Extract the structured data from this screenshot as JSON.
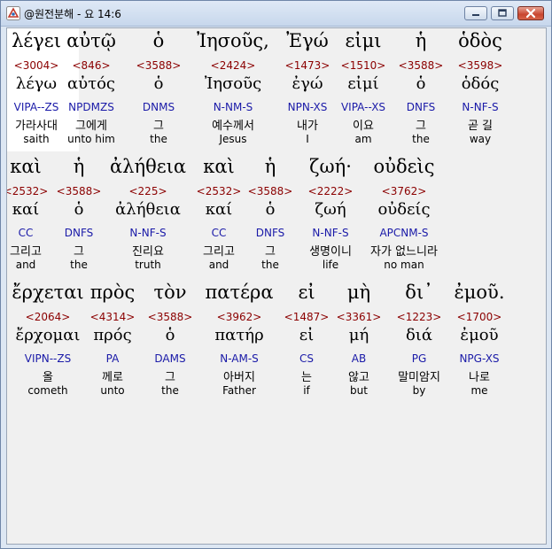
{
  "window": {
    "title": "@원전분해 - 요 14:6",
    "icon": "app-icon",
    "controls": [
      "minimize-icon",
      "maximize-icon",
      "close-icon"
    ]
  },
  "colors": {
    "strongs_number": "#8b0000",
    "parsing_code": "#1a1aa8",
    "text": "#000000",
    "selected_bg": "#ffffff",
    "client_bg": "#f0f0f0"
  },
  "lines": [
    {
      "words": [
        {
          "greek": "λέγει",
          "strongs": "<3004>",
          "lemma": "λέγω",
          "parsing": "VIPA--ZS",
          "korean": "가라사대",
          "english": "saith"
        },
        {
          "greek": "αὐτῷ",
          "strongs": "<846>",
          "lemma": "αὐτός",
          "parsing": "NPDMZS",
          "korean": "그에게",
          "english": "unto him"
        },
        {
          "greek": "ὁ",
          "strongs": "<3588>",
          "lemma": "ὁ",
          "parsing": "DNMS",
          "korean": "그",
          "english": "the"
        },
        {
          "greek": "Ἰησοῦς,",
          "strongs": "<2424>",
          "lemma": "Ἰησοῦς",
          "parsing": "N-NM-S",
          "korean": "예수께서",
          "english": "Jesus"
        },
        {
          "greek": "Ἐγώ",
          "strongs": "<1473>",
          "lemma": "ἐγώ",
          "parsing": "NPN-XS",
          "korean": "내가",
          "english": "I"
        },
        {
          "greek": "εἰμι",
          "strongs": "<1510>",
          "lemma": "εἰμί",
          "parsing": "VIPA--XS",
          "korean": "이요",
          "english": "am"
        },
        {
          "greek": "ἡ",
          "strongs": "<3588>",
          "lemma": "ὁ",
          "parsing": "DNFS",
          "korean": "그",
          "english": "the"
        },
        {
          "greek": "ὁδὸς",
          "strongs": "<3598>",
          "lemma": "ὁδός",
          "parsing": "N-NF-S",
          "korean": "곧 길",
          "english": "way"
        }
      ]
    },
    {
      "words": [
        {
          "greek": "καὶ",
          "strongs": "<2532>",
          "lemma": "καί",
          "parsing": "CC",
          "korean": "그리고",
          "english": "and"
        },
        {
          "greek": "ἡ",
          "strongs": "<3588>",
          "lemma": "ὁ",
          "parsing": "DNFS",
          "korean": "그",
          "english": "the"
        },
        {
          "greek": "ἀλήθεια",
          "strongs": "<225>",
          "lemma": "ἀλήθεια",
          "parsing": "N-NF-S",
          "korean": "진리요",
          "english": "truth"
        },
        {
          "greek": "καὶ",
          "strongs": "<2532>",
          "lemma": "καί",
          "parsing": "CC",
          "korean": "그리고",
          "english": "and"
        },
        {
          "greek": "ἡ",
          "strongs": "<3588>",
          "lemma": "ὁ",
          "parsing": "DNFS",
          "korean": "그",
          "english": "the"
        },
        {
          "greek": "ζωή·",
          "strongs": "<2222>",
          "lemma": "ζωή",
          "parsing": "N-NF-S",
          "korean": "생명이니",
          "english": "life"
        },
        {
          "greek": "οὐδεὶς",
          "strongs": "<3762>",
          "lemma": "οὐδείς",
          "parsing": "APCNM-S",
          "korean": "자가 없느니라",
          "english": "no man"
        }
      ]
    },
    {
      "words": [
        {
          "greek": "ἔρχεται",
          "strongs": "<2064>",
          "lemma": "ἔρχομαι",
          "parsing": "VIPN--ZS",
          "korean": "올",
          "english": "cometh"
        },
        {
          "greek": "πρὸς",
          "strongs": "<4314>",
          "lemma": "πρός",
          "parsing": "PA",
          "korean": "께로",
          "english": "unto"
        },
        {
          "greek": "τὸν",
          "strongs": "<3588>",
          "lemma": "ὁ",
          "parsing": "DAMS",
          "korean": "그",
          "english": "the"
        },
        {
          "greek": "πατέρα",
          "strongs": "<3962>",
          "lemma": "πατήρ",
          "parsing": "N-AM-S",
          "korean": "아버지",
          "english": "Father"
        },
        {
          "greek": "εἰ",
          "strongs": "<1487>",
          "lemma": "εἰ",
          "parsing": "CS",
          "korean": "는",
          "english": "if"
        },
        {
          "greek": "μὴ",
          "strongs": "<3361>",
          "lemma": "μή",
          "parsing": "AB",
          "korean": "않고",
          "english": "but"
        },
        {
          "greek": "δι᾽",
          "strongs": "<1223>",
          "lemma": "διά",
          "parsing": "PG",
          "korean": "말미암지",
          "english": "by"
        },
        {
          "greek": "ἐμοῦ.",
          "strongs": "<1700>",
          "lemma": "ἐμοῦ",
          "parsing": "NPG-XS",
          "korean": "나로",
          "english": "me"
        }
      ]
    }
  ]
}
